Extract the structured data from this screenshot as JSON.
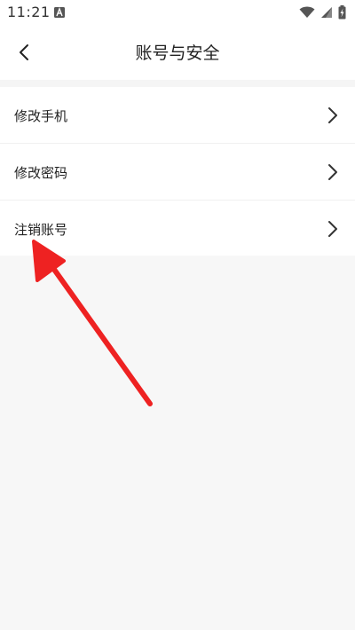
{
  "status_bar": {
    "time": "11:21",
    "notification_icon": "a-letter-icon",
    "icons": [
      "wifi-icon",
      "signal-icon",
      "battery-charging-icon"
    ]
  },
  "header": {
    "back_icon": "chevron-left-icon",
    "title": "账号与安全"
  },
  "menu": {
    "items": [
      {
        "label": "修改手机",
        "icon": "chevron-right-icon"
      },
      {
        "label": "修改密码",
        "icon": "chevron-right-icon"
      },
      {
        "label": "注销账号",
        "icon": "chevron-right-icon"
      }
    ]
  },
  "annotation": {
    "icon": "red-arrow-icon",
    "color": "#ee2222"
  },
  "colors": {
    "background": "#f7f7f7",
    "surface": "#ffffff",
    "text": "#222222",
    "divider": "#f0f0f0"
  }
}
